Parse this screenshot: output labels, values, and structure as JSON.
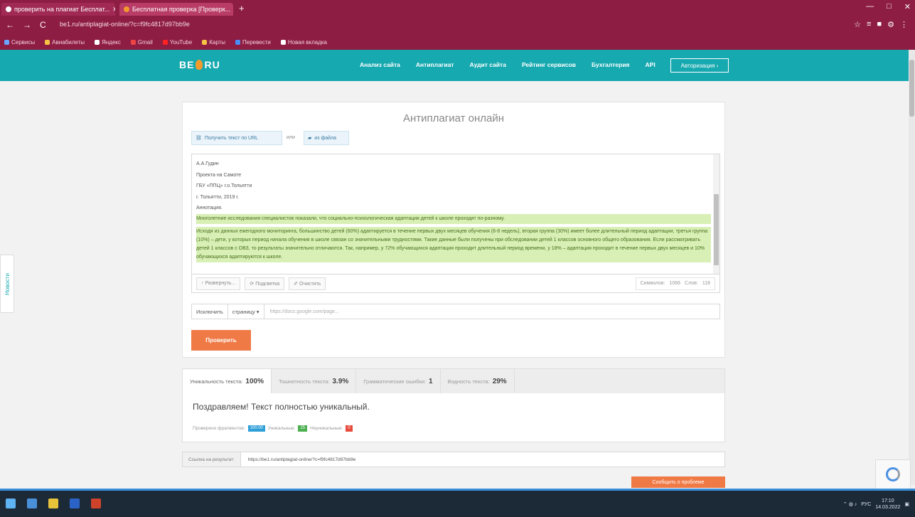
{
  "browser": {
    "tabs": [
      {
        "title": "проверить на плагиат Бесплат..."
      },
      {
        "title": "Бесплатная проверка [Проверк..."
      }
    ],
    "new_tab": "+",
    "window_controls": [
      "—",
      "□",
      "✕"
    ],
    "nav": [
      "←",
      "→",
      "C"
    ],
    "url": "be1.ru/antiplagiat-online/?c=f9fc4817d97bb9e",
    "extensions": [
      "☆",
      "≡",
      "■",
      "⚙",
      "⋮"
    ],
    "bookmarks": [
      "Сервисы",
      "Авиабилеты",
      "Яндекс",
      "Gmail",
      "YouTube",
      "Карты",
      "Перевести",
      "Новая вкладка"
    ]
  },
  "site": {
    "logo_left": "BE",
    "logo_right": "RU",
    "nav": [
      "Анализ сайта",
      "Антиплагиат",
      "Аудит сайта",
      "Рейтинг сервисов",
      "Бухгалтерия",
      "API"
    ],
    "login": "Авторизация ›"
  },
  "sidebar": {
    "news": "Новости"
  },
  "checker": {
    "title": "Антиплагиат онлайн",
    "load_url_btn": "Получить текст по URL",
    "or": "или",
    "load_file_btn": "из файла",
    "text_lines": [
      "А.А.Гудин",
      "Проекта на Самоте",
      "ГБУ «ППЦ» г.о.Тольятти",
      "г. Тольятти, 2019 г.",
      "Аннотация."
    ],
    "highlight_1": "Многолетние исследования специалистов показали, что социально-психологическая адаптация детей к школе проходит по-разному.",
    "highlight_2": "Исходя из данных ежегодного мониторинга, большинство детей (60%) адаптируется в течение первых двух месяцев обучения (6-8 недель), вторая группа (30%) имеет более длительный период адаптации, третья группа (10%) – дети, у которых период начала обучения в школе связан со значительными трудностями. Такие данные были получены при обследовании детей 1 классов основного общего образования. Если рассматривать детей 1 классов с ОВЗ, то результаты значительно отличаются. Так, например, у 72% обучающихся адаптация проходит длительный период времени, у 18% – адаптация проходит в течение первых двух месяцев и 10% обучающихся адаптируются к школе.",
    "tools": [
      "↑ Развернуть...",
      "⟳ Подсветка",
      "✐ Очистить"
    ],
    "stats_chars_label": "Символов:",
    "stats_chars_val": "1066",
    "stats_words_label": "Слов:",
    "stats_words_val": "118",
    "exclude_label": "Исключить",
    "exclude_select": "страницу ▾",
    "exclude_placeholder": "https://docs.google.com/page...",
    "check_btn": "Проверить"
  },
  "results": {
    "tabs": [
      {
        "label": "Уникальность текста:",
        "value": "100%"
      },
      {
        "label": "Тошнотность текста:",
        "value": "3.9%"
      },
      {
        "label": "Грамматические ошибки:",
        "value": "1"
      },
      {
        "label": "Водность текста:",
        "value": "29%"
      }
    ],
    "message": "Поздравляем! Текст полностью уникальный.",
    "legend_checked": "Проверено фрагментов:",
    "legend_checked_val": "100.00",
    "legend_unique": "Уникальные:",
    "legend_unique_val": "25",
    "legend_nonunique": "Неуникальные:",
    "legend_nonunique_val": "0",
    "colors": {
      "checked": "#2f9fd8",
      "unique": "#4caf50",
      "nonunique": "#e74c3c"
    }
  },
  "link": {
    "label": "Ссылка на результат:",
    "value": "https://be1.ru/antiplagiat-online/?c=f9fc4817d97bb9e"
  },
  "report_btn": "Сообщить о проблеме",
  "taskbar": {
    "time": "17:10",
    "date": "14.03.2022",
    "lang": "РУС"
  }
}
